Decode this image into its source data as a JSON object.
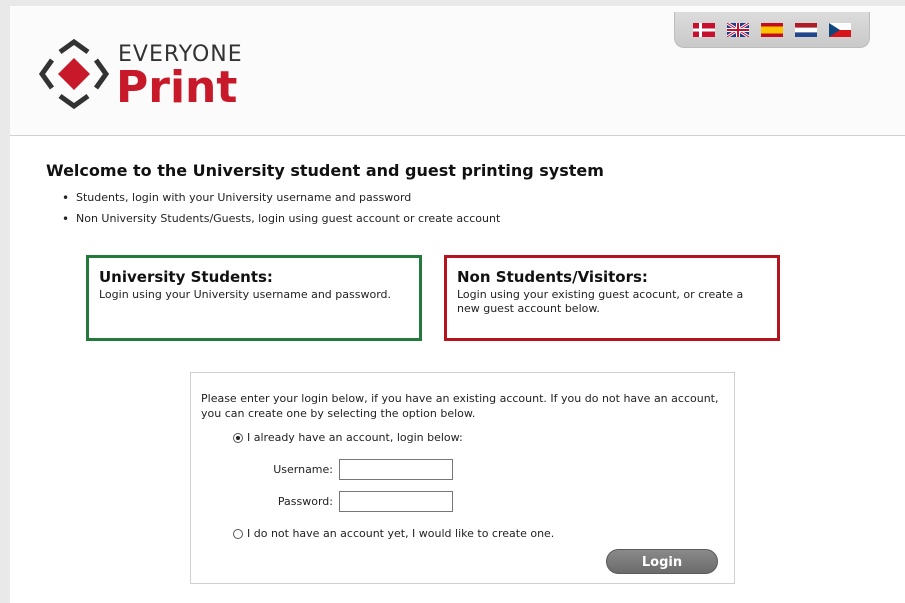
{
  "brand": {
    "top_text": "EVERYONE",
    "bottom_text": "Print",
    "accent_color": "#c8192b"
  },
  "languages": [
    {
      "name": "danish-flag-icon"
    },
    {
      "name": "uk-flag-icon"
    },
    {
      "name": "spain-flag-icon"
    },
    {
      "name": "netherlands-flag-icon"
    },
    {
      "name": "czech-flag-icon"
    }
  ],
  "main": {
    "title": "Welcome to the University student and guest printing system",
    "bullets": [
      "Students, login with your University username and password",
      "Non University Students/Guests, login using guest account or create account"
    ]
  },
  "university_box": {
    "title": "University Students:",
    "text": "Login using your University username and password.",
    "border_color": "#237a3a"
  },
  "visitor_box": {
    "title": "Non Students/Visitors:",
    "text": "Login using your existing guest acocunt, or create a new guest account below.",
    "border_color": "#b3141d"
  },
  "login": {
    "intro": "Please enter your login below, if you have an existing account. If you do not have an account, you can create one by selecting the option below.",
    "option_existing": "I already have an account, login below:",
    "username_label": "Username:",
    "username_value": "",
    "password_label": "Password:",
    "password_value": "",
    "option_create": "I do not have an account yet, I would like to create one.",
    "button_label": "Login"
  }
}
